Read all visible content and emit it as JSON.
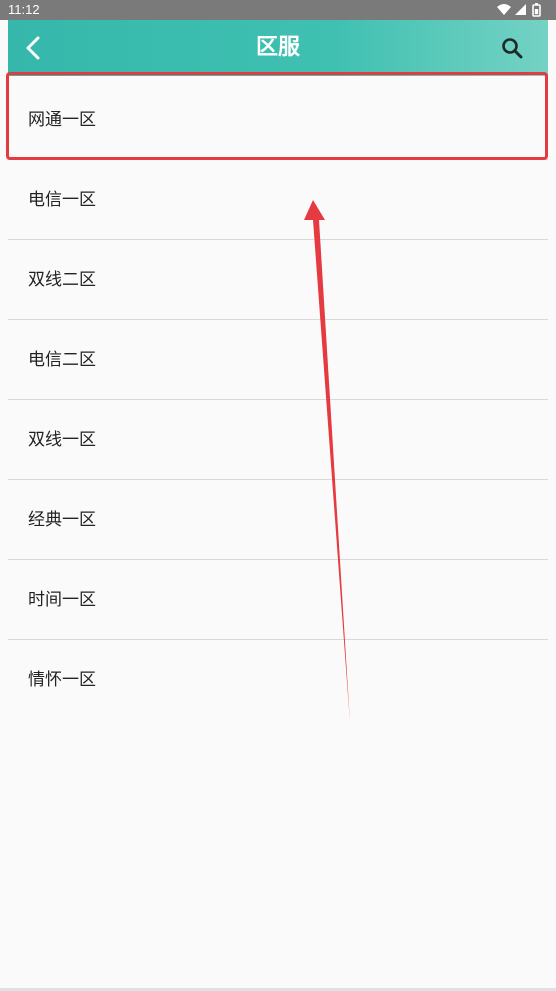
{
  "status_bar": {
    "time": "11:12",
    "icons": [
      "wifi-icon",
      "cellular-icon",
      "battery-icon"
    ]
  },
  "header": {
    "title": "区服",
    "back_icon": "chevron-left-icon",
    "search_icon": "search-icon",
    "gradient_colors": [
      "#35b8ab",
      "#74d2c4"
    ]
  },
  "servers": [
    {
      "label": "网通一区"
    },
    {
      "label": "电信一区"
    },
    {
      "label": "双线二区"
    },
    {
      "label": "电信二区"
    },
    {
      "label": "双线一区"
    },
    {
      "label": "经典一区"
    },
    {
      "label": "时间一区"
    },
    {
      "label": "情怀一区"
    }
  ],
  "annotation": {
    "highlight_color": "#e53a3f",
    "arrow_color": "#e53a3f"
  }
}
